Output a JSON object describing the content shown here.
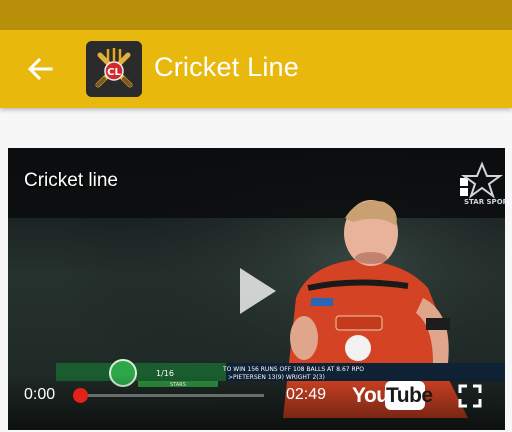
{
  "app_bar": {
    "title": "Cricket Line",
    "back_icon": "arrow-back-icon",
    "logo_icon": "cricket-line-logo"
  },
  "player": {
    "video_title": "Cricket line",
    "time_current": "0:00",
    "time_total": "02:49",
    "progress": 0.0,
    "brand_you": "You",
    "brand_tube": "Tube",
    "play_icon": "play-icon",
    "fullscreen_icon": "fullscreen-icon",
    "channel_watermark": "star-sports-logo"
  },
  "colors": {
    "status_bar": "#b8900a",
    "app_bar": "#e8b80c",
    "progress": "#e62117"
  }
}
